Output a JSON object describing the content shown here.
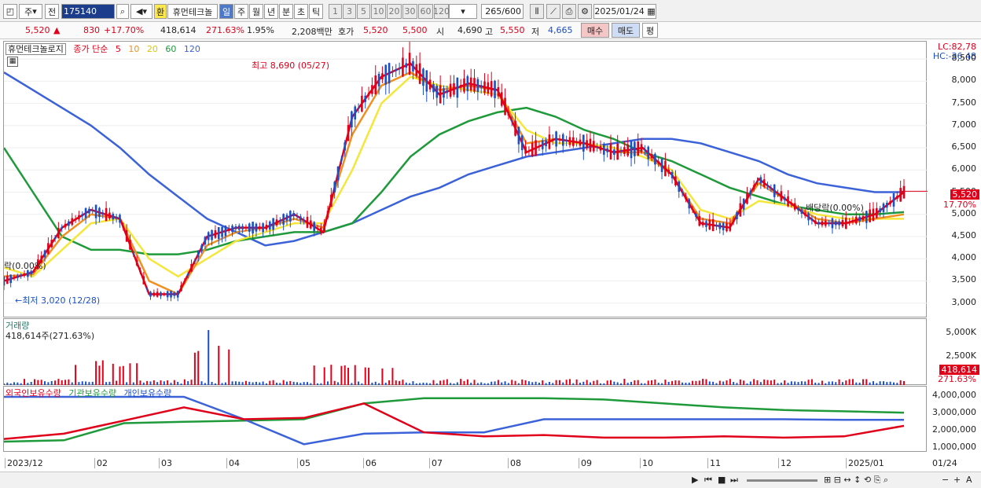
{
  "toolbar": {
    "market": "주",
    "prev": "전",
    "code": "175140",
    "hwan": "환",
    "name": "휴먼테크놀",
    "periods": [
      "일",
      "주",
      "월",
      "년",
      "분",
      "초",
      "틱"
    ],
    "numbers": [
      "1",
      "3",
      "5",
      "10",
      "20",
      "30",
      "60",
      "120"
    ],
    "count": "265",
    "count_total": "/600",
    "date": "2025/01/24"
  },
  "quote": {
    "price": "5,520",
    "change": "830",
    "change_pct": "+17.70%",
    "volume": "418,614",
    "volume_pct": "271.63%",
    "turnover_pct": "1.95%",
    "amount": "2,208백만",
    "bid_label": "호가",
    "ask": "5,520",
    "bid": "5,500",
    "open_label": "시",
    "open": "4,690",
    "high_label": "고",
    "high": "5,550",
    "low_label": "저",
    "low": "4,665",
    "buy_label": "매수",
    "sell_label": "매도",
    "close_label": "평"
  },
  "price_panel": {
    "stock_label": "휴먼테크놀로지",
    "ma_title": "종가 단순",
    "ma_periods": [
      "5",
      "10",
      "20",
      "60",
      "120"
    ],
    "high_note": "최고 8,690 (05/27)",
    "low_note": "←최저 3,020 (12/28)",
    "left_note": "락(0.00%)",
    "ex_note": "배당락(0.00%)",
    "lc": "LC:82,78",
    "hc": "HC:-36,48",
    "current": "5,520",
    "current_pct": "17.70%",
    "ticks": [
      "8,500",
      "8,000",
      "7,500",
      "7,000",
      "6,500",
      "6,000",
      "5,500",
      "5,000",
      "4,500",
      "4,000",
      "3,500",
      "3,000"
    ]
  },
  "volume_panel": {
    "title": "거래량",
    "info": "418,614주(271.63%)",
    "ticks": [
      "5,000K",
      "2,500K"
    ],
    "current": "418,614",
    "current_pct": "271.63%"
  },
  "holding_panel": {
    "foreign": "외국인보유수량",
    "institution": "기관보유수량",
    "individual": "개인보유수량",
    "ticks": [
      "4,000,000",
      "3,000,000",
      "2,000,000",
      "1,000,000"
    ]
  },
  "dates": [
    "2023/12",
    "02",
    "03",
    "04",
    "05",
    "06",
    "07",
    "08",
    "09",
    "10",
    "11",
    "12",
    "2025/01"
  ],
  "date_right": "01/24",
  "colors": {
    "up": "#e0001a",
    "down": "#1a4fc9",
    "ma5": "#e0001a",
    "ma10": "#f09020",
    "ma20": "#f5e63a",
    "ma60": "#1f9a3a",
    "ma120": "#3b62d8"
  },
  "chart_data": {
    "type": "line",
    "title": "휴먼테크놀로지",
    "ylim": [
      2800,
      8750
    ],
    "x_labels": [
      "2023/12",
      "02",
      "03",
      "04",
      "05",
      "06",
      "07",
      "08",
      "09",
      "10",
      "11",
      "12",
      "2025/01"
    ],
    "series": [
      {
        "name": "5",
        "values": [
          3500,
          3700,
          4700,
          5100,
          4900,
          3200,
          3200,
          4500,
          4700,
          4700,
          5000,
          4600,
          7200,
          8100,
          8400,
          7700,
          7950,
          7800,
          6400,
          6700,
          6600,
          6400,
          6500,
          5900,
          4800,
          4700,
          5800,
          5300,
          4800,
          4800,
          5000,
          5500
        ]
      },
      {
        "name": "10",
        "values": [
          3600,
          3650,
          4500,
          5000,
          4900,
          3500,
          3200,
          4300,
          4600,
          4700,
          4900,
          4700,
          6800,
          7900,
          8200,
          7800,
          7900,
          7800,
          6600,
          6700,
          6600,
          6400,
          6400,
          5900,
          4900,
          4800,
          5700,
          5300,
          4900,
          4800,
          4900,
          5000
        ]
      },
      {
        "name": "20",
        "values": [
          3800,
          3600,
          4200,
          4800,
          4900,
          4000,
          3600,
          4000,
          4400,
          4600,
          4800,
          4800,
          6000,
          7500,
          8100,
          7900,
          7800,
          7700,
          6900,
          6600,
          6600,
          6500,
          6300,
          6000,
          5100,
          4900,
          5300,
          5200,
          5000,
          4900,
          4900,
          4900
        ]
      },
      {
        "name": "60",
        "values": [
          6500,
          5500,
          4500,
          4200,
          4200,
          4100,
          4100,
          4200,
          4400,
          4500,
          4600,
          4600,
          4800,
          5500,
          6300,
          6800,
          7100,
          7300,
          7400,
          7200,
          6900,
          6700,
          6400,
          6200,
          5900,
          5600,
          5400,
          5200,
          5100,
          5000,
          5000,
          5050
        ]
      },
      {
        "name": "120",
        "values": [
          8200,
          7800,
          7400,
          7000,
          6500,
          5900,
          5400,
          4900,
          4600,
          4300,
          4400,
          4600,
          4800,
          5100,
          5400,
          5600,
          5900,
          6100,
          6300,
          6400,
          6500,
          6600,
          6700,
          6700,
          6600,
          6400,
          6200,
          5900,
          5700,
          5600,
          5500,
          5500
        ]
      }
    ]
  }
}
